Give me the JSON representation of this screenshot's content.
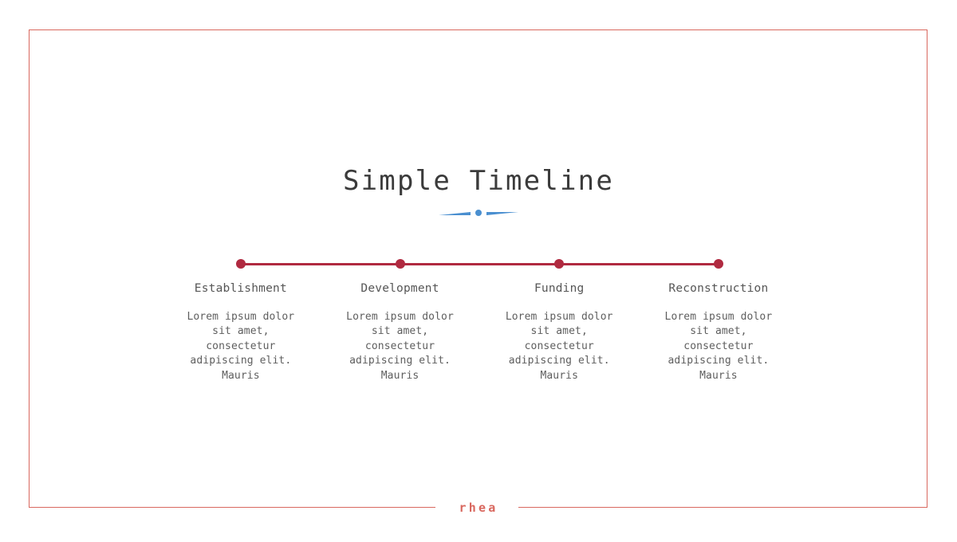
{
  "slide": {
    "title": "Simple Timeline",
    "background_color": "#ffffff",
    "frame_color": "#d9685f",
    "accent_color": "#b02a40",
    "divider_color": "#4a8fd0",
    "text_color": "#565656"
  },
  "divider": {
    "icon": "dot-with-tapered-lines-divider"
  },
  "timeline": {
    "nodes": [
      {
        "label": "Establishment",
        "body": "Lorem ipsum dolor sit amet, consectetur adipiscing elit. Mauris"
      },
      {
        "label": "Development",
        "body": "Lorem ipsum dolor sit amet, consectetur adipiscing elit. Mauris"
      },
      {
        "label": "Funding",
        "body": "Lorem ipsum dolor sit amet, consectetur adipiscing elit. Mauris"
      },
      {
        "label": "Reconstruction",
        "body": "Lorem ipsum dolor sit amet, consectetur adipiscing elit. Mauris"
      }
    ]
  },
  "footer": {
    "wordmark": "rhea"
  }
}
